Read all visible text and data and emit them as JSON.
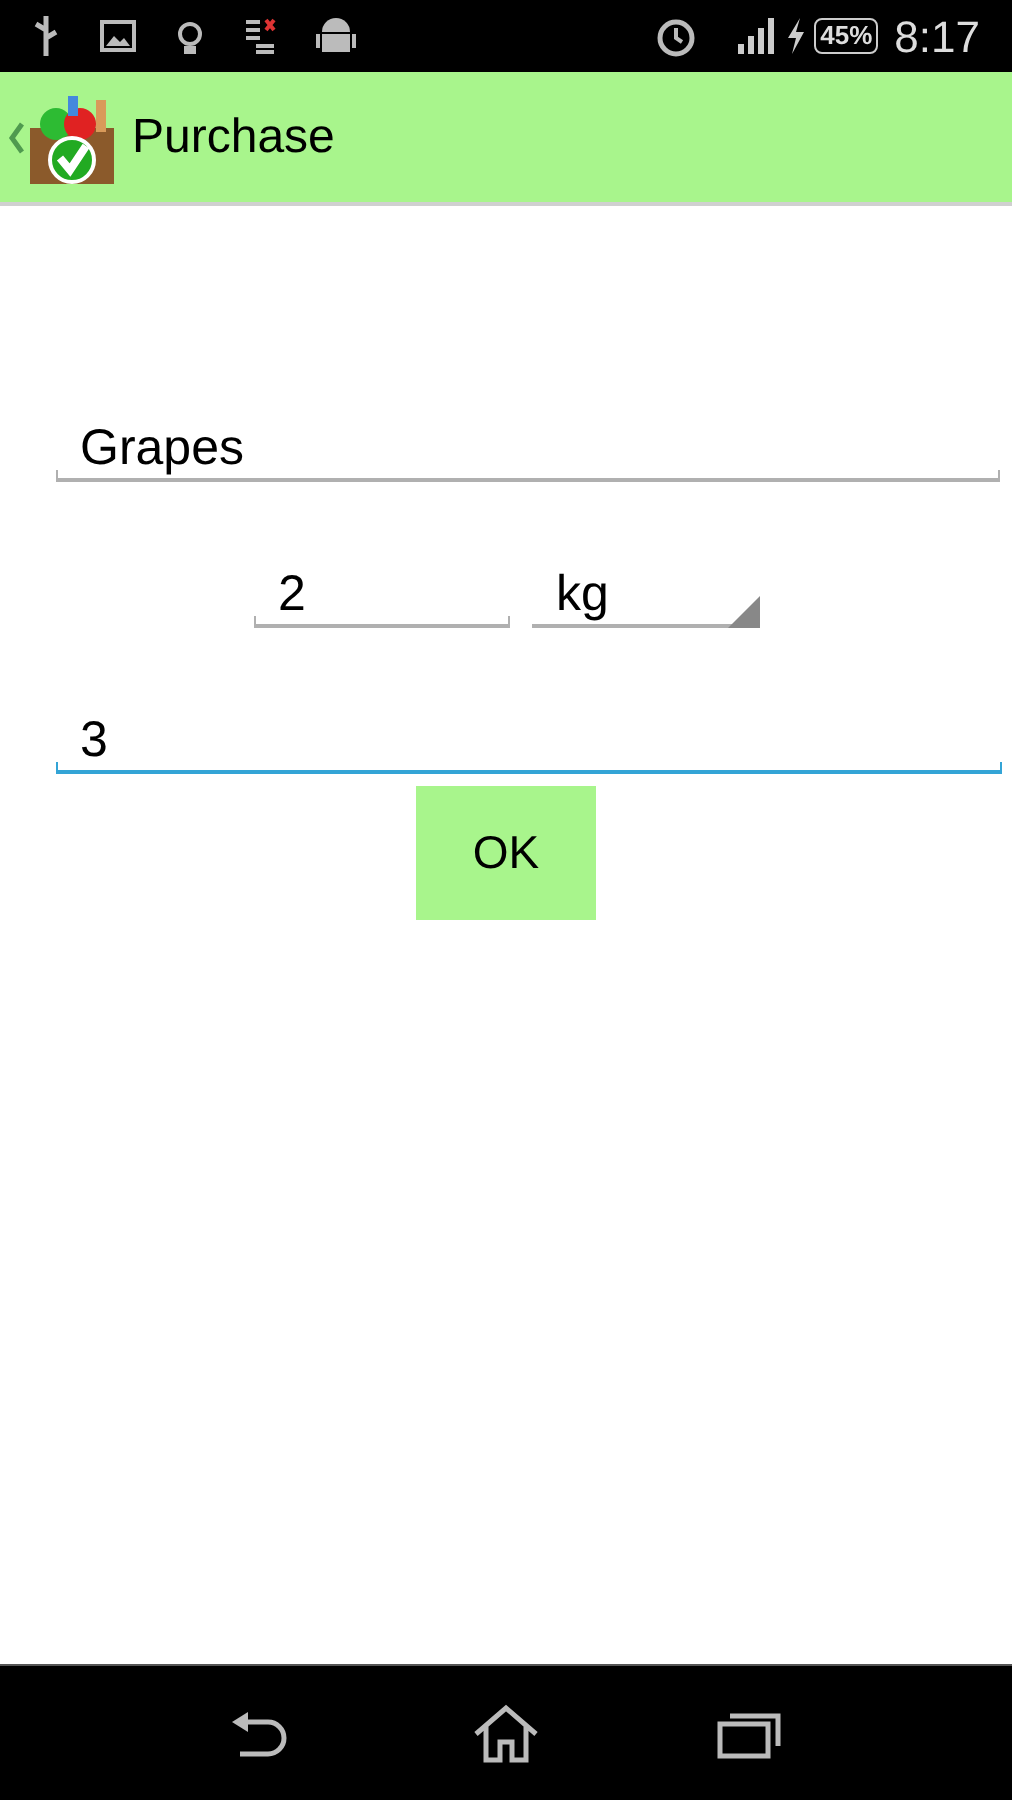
{
  "status_bar": {
    "battery": "45%",
    "time": "8:17"
  },
  "action_bar": {
    "title": "Purchase"
  },
  "form": {
    "name_field": {
      "value": "Grapes",
      "focused": false
    },
    "quantity_field": {
      "value": "2",
      "focused": false
    },
    "unit_dropdown": {
      "value": "kg"
    },
    "field_3": {
      "value": "3",
      "focused": true
    },
    "ok_button": {
      "label": "OK"
    }
  }
}
